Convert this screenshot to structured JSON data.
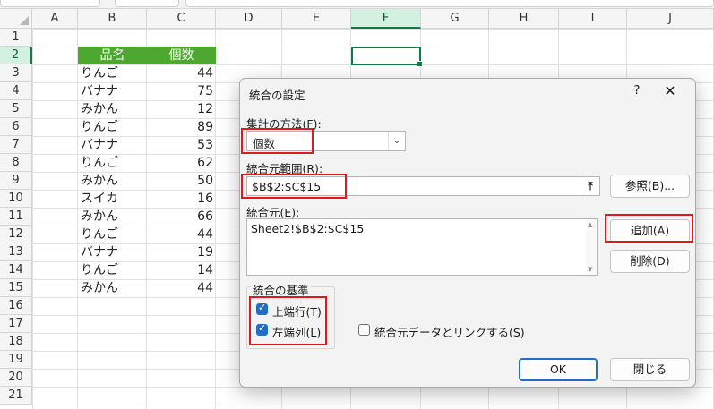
{
  "spreadsheet": {
    "columns": [
      "A",
      "B",
      "C",
      "D",
      "E",
      "F",
      "G",
      "H",
      "I",
      "J"
    ],
    "selected_column": "F",
    "rows": [
      "1",
      "2",
      "3",
      "4",
      "5",
      "6",
      "7",
      "8",
      "9",
      "10",
      "11",
      "12",
      "13",
      "14",
      "15",
      "16",
      "17",
      "18",
      "19",
      "20",
      "21"
    ],
    "selected_row": "2",
    "table_header": {
      "name": "品名",
      "count": "個数"
    },
    "table_rows": [
      {
        "name": "りんご",
        "count": "44"
      },
      {
        "name": "バナナ",
        "count": "75"
      },
      {
        "name": "みかん",
        "count": "12"
      },
      {
        "name": "りんご",
        "count": "89"
      },
      {
        "name": "バナナ",
        "count": "53"
      },
      {
        "name": "りんご",
        "count": "62"
      },
      {
        "name": "みかん",
        "count": "50"
      },
      {
        "name": "スイカ",
        "count": "16"
      },
      {
        "name": "みかん",
        "count": "66"
      },
      {
        "name": "りんご",
        "count": "44"
      },
      {
        "name": "バナナ",
        "count": "19"
      },
      {
        "name": "りんご",
        "count": "14"
      },
      {
        "name": "みかん",
        "count": "44"
      }
    ],
    "header_fill_color": "#4ea72e",
    "selection_color": "#107c41"
  },
  "dialog": {
    "title": "統合の設定",
    "help": "?",
    "close": "✕",
    "function_label": "集計の方法(F):",
    "function_value": "個数",
    "reference_label": "統合元範囲(R):",
    "reference_value": "$B$2:$C$15",
    "browse_button": "参照(B)...",
    "all_references_label": "統合元(E):",
    "all_references": [
      "Sheet2!$B$2:$C$15"
    ],
    "add_button": "追加(A)",
    "delete_button": "削除(D)",
    "use_labels_group": "統合の基準",
    "top_row_label": "上端行(T)",
    "top_row_checked": true,
    "left_column_label": "左端列(L)",
    "left_column_checked": true,
    "create_links_label": "統合元データとリンクする(S)",
    "create_links_checked": false,
    "ok_button": "OK",
    "close_button": "閉じる",
    "highlight_color": "#e0191f",
    "primary_color": "#1f6fc8"
  }
}
